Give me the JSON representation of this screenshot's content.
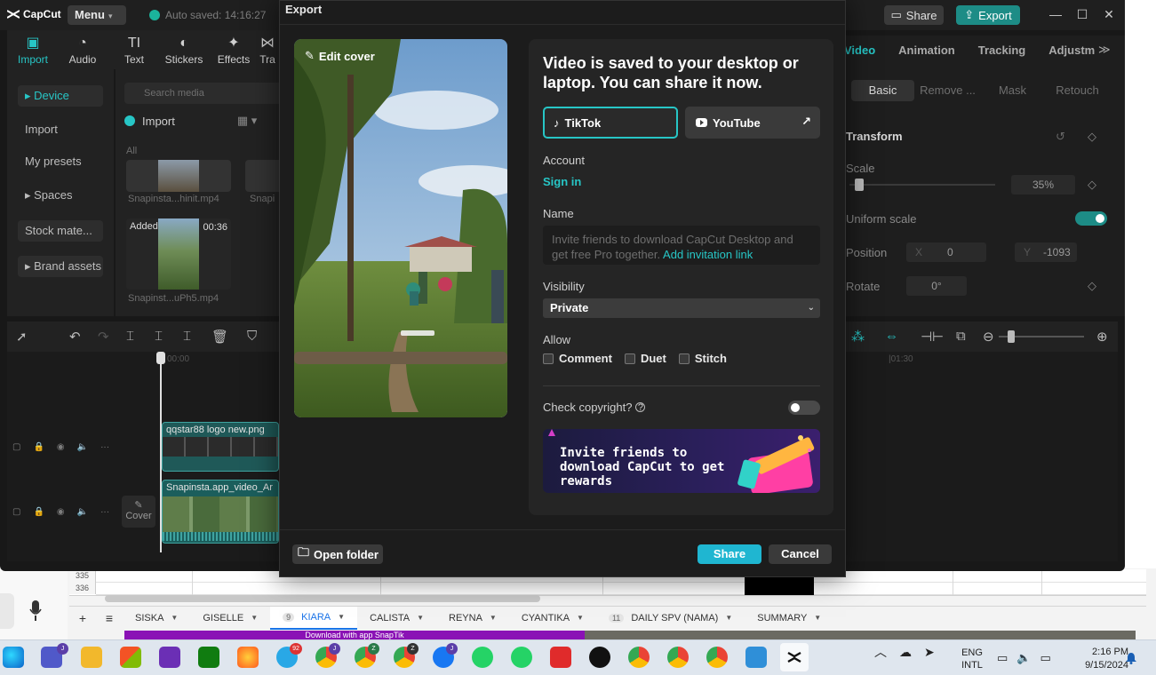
{
  "capcut": {
    "logo": "CapCut",
    "menu": "Menu",
    "autosave": "Auto saved: 14:16:27",
    "share": "Share",
    "export": "Export",
    "tools": [
      {
        "label": "Import",
        "icon": "import-icon"
      },
      {
        "label": "Audio",
        "icon": "audio-icon"
      },
      {
        "label": "Text",
        "icon": "text-icon"
      },
      {
        "label": "Stickers",
        "icon": "stickers-icon"
      },
      {
        "label": "Effects",
        "icon": "effects-icon"
      },
      {
        "label": "Tra",
        "icon": "transitions-icon"
      }
    ],
    "leftnav": [
      "Device",
      "Import",
      "My presets",
      "Spaces",
      "Stock mate...",
      "Brand assets"
    ],
    "search_placeholder": "Search media",
    "import_label": "Import",
    "all_label": "All",
    "media": [
      {
        "caption": "Snapinsta...hinit.mp4"
      },
      {
        "caption": "Snapi"
      },
      {
        "caption": "Snapinst...uPh5.mp4",
        "badge": "Added",
        "duration": "00:36"
      }
    ],
    "right_tabs": [
      "Video",
      "Animation",
      "Tracking",
      "Adjustm"
    ],
    "right_subtabs": [
      "Basic",
      "Remove ...",
      "Mask",
      "Retouch"
    ],
    "transform": "Transform",
    "scale_label": "Scale",
    "scale_value": "35%",
    "uniform_scale": "Uniform scale",
    "position_label": "Position",
    "pos_x_label": "X",
    "pos_x": "0",
    "pos_y_label": "Y",
    "pos_y": "-1093",
    "rotate_label": "Rotate",
    "rotate_value": "0°",
    "timecode_start": "00:00",
    "timecode_right": "|01:30",
    "track1_label": "qqstar88 logo new.png",
    "track2_label": "Snapinsta.app_video_Ar",
    "cover": "Cover"
  },
  "export_dialog": {
    "title": "Export",
    "edit_cover": "Edit cover",
    "headline": "Video is saved to your desktop or laptop. You can share it now.",
    "tiktok": "TikTok",
    "youtube": "YouTube",
    "account_label": "Account",
    "sign_in": "Sign in",
    "name_label": "Name",
    "name_placeholder": "Invite friends to download CapCut Desktop and get free Pro together.",
    "invite_link": "Add invitation link",
    "visibility_label": "Visibility",
    "visibility_value": "Private",
    "allow_label": "Allow",
    "allow_options": [
      "Comment",
      "Duet",
      "Stitch"
    ],
    "copyright_label": "Check copyright?",
    "promo_text": "Invite friends to download CapCut to get rewards",
    "open_folder": "Open folder",
    "share": "Share",
    "cancel": "Cancel"
  },
  "spreadsheet": {
    "rows": [
      "335",
      "336"
    ],
    "tabs": [
      {
        "label": "SISKA"
      },
      {
        "label": "GISELLE"
      },
      {
        "label": "KIARA",
        "num": "9",
        "active": true
      },
      {
        "label": "CALISTA"
      },
      {
        "label": "REYNA"
      },
      {
        "label": "CYANTIKA"
      },
      {
        "label": "DAILY SPV (NAMA)",
        "num": "11"
      },
      {
        "label": "SUMMARY"
      }
    ],
    "banner": "Download with app SnapTik"
  },
  "taskbar": {
    "lang_top": "ENG",
    "lang_bottom": "INTL",
    "time": "2:16 PM",
    "date": "9/15/2024",
    "badges": {
      "telegram": "92",
      "chrome1": "J",
      "chrome2": "Z",
      "chrome3": "Z",
      "facebook": "J"
    }
  },
  "colors": {
    "accent": "#27c6c6",
    "share_button": "#1fb6d1",
    "export_button": "#1d8c86",
    "dialog_bg": "#1c1c1c",
    "panel_bg": "#252525"
  }
}
